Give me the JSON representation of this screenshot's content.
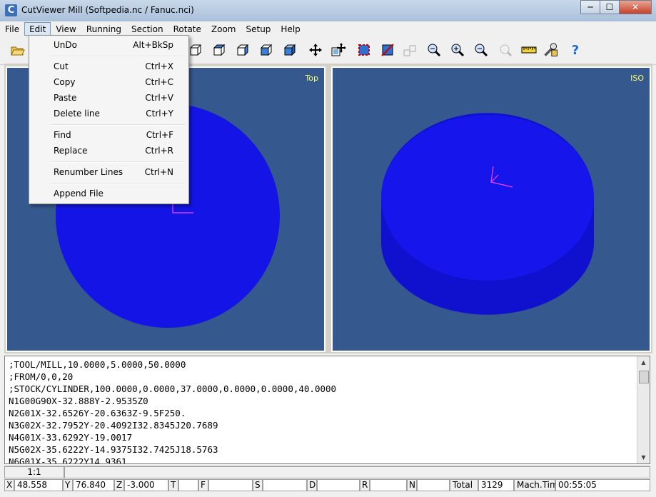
{
  "window": {
    "title": "CutViewer Mill (Softpedia.nc / Fanuc.nci)",
    "min": "─",
    "max": "☐",
    "close": "✕"
  },
  "menu": [
    "File",
    "Edit",
    "View",
    "Running",
    "Section",
    "Rotate",
    "Zoom",
    "Setup",
    "Help"
  ],
  "edit_menu": [
    {
      "label": "UnDo",
      "shortcut": "Alt+BkSp"
    },
    {
      "label": "Cut",
      "shortcut": "Ctrl+X"
    },
    {
      "label": "Copy",
      "shortcut": "Ctrl+C"
    },
    {
      "label": "Paste",
      "shortcut": "Ctrl+V"
    },
    {
      "label": "Delete line",
      "shortcut": "Ctrl+Y"
    },
    {
      "label": "Find",
      "shortcut": "Ctrl+F"
    },
    {
      "label": "Replace",
      "shortcut": "Ctrl+R"
    },
    {
      "label": "Renumber Lines",
      "shortcut": "Ctrl+N"
    },
    {
      "label": "Append File",
      "shortcut": ""
    }
  ],
  "views": {
    "top_label": "Top",
    "iso_label": "ISO",
    "bg_color": "#35588f",
    "stock_color": "#1414e6"
  },
  "code_lines": [
    ";TOOL/MILL,10.0000,5.0000,50.0000",
    ";FROM/0,0,20",
    ";STOCK/CYLINDER,100.0000,0.0000,37.0000,0.0000,0.0000,40.0000",
    "N1G00G90X-32.888Y-2.9535Z0",
    "N2G01X-32.6526Y-20.6363Z-9.5F250.",
    "N3G02X-32.7952Y-20.4092I32.8345J20.7689",
    "N4G01X-33.6292Y-19.0017",
    "N5G02X-35.6222Y-14.9375I32.7425J18.5763",
    "N6G01X-35.6222Y14.9361"
  ],
  "status": {
    "line_pos": "1:1",
    "x_label": "X",
    "x_value": "48.558",
    "y_label": "Y",
    "y_value": "76.840",
    "z_label": "Z",
    "z_value": "-3.000",
    "t_label": "T",
    "t_value": "",
    "f_label": "F",
    "f_value": "",
    "s_label": "S",
    "s_value": "",
    "d_label": "D",
    "d_value": "",
    "r_label": "R",
    "r_value": "",
    "n_label": "N",
    "n_value": "",
    "total_label": "Total",
    "total_value": "3129",
    "mach_label": "Mach.Tim",
    "mach_value": "00:55:05"
  }
}
